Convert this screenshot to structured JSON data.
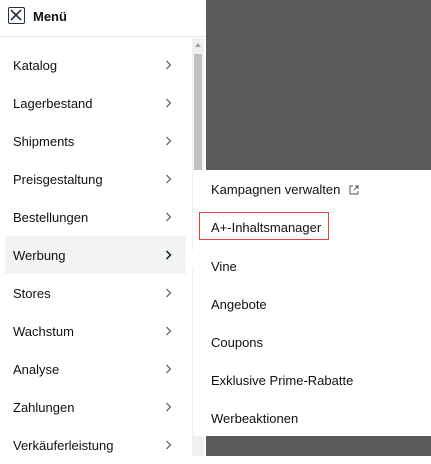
{
  "header": {
    "title": "Menü",
    "close_icon": "close-box-icon"
  },
  "menu": [
    {
      "label": "Katalog"
    },
    {
      "label": "Lagerbestand"
    },
    {
      "label": "Shipments"
    },
    {
      "label": "Preisgestaltung"
    },
    {
      "label": "Bestellungen"
    },
    {
      "label": "Werbung",
      "active": true
    },
    {
      "label": "Stores"
    },
    {
      "label": "Wachstum"
    },
    {
      "label": "Analyse"
    },
    {
      "label": "Zahlungen"
    },
    {
      "label": "Verkäuferleistung"
    }
  ],
  "submenu": {
    "items": [
      {
        "label": "Kampagnen verwalten",
        "icon": "external-link-icon"
      },
      {
        "label": "A+-Inhaltsmanager",
        "highlighted": true
      },
      {
        "label": "Vine"
      },
      {
        "label": "Angebote"
      },
      {
        "label": "Coupons"
      },
      {
        "label": "Exklusive Prime-Rabatte"
      },
      {
        "label": "Werbeaktionen"
      }
    ]
  },
  "colors": {
    "overlay": "#5a5a5a",
    "active_bg": "#f2f4f4",
    "highlight_border": "#e53d3d",
    "text": "#0f1111"
  }
}
